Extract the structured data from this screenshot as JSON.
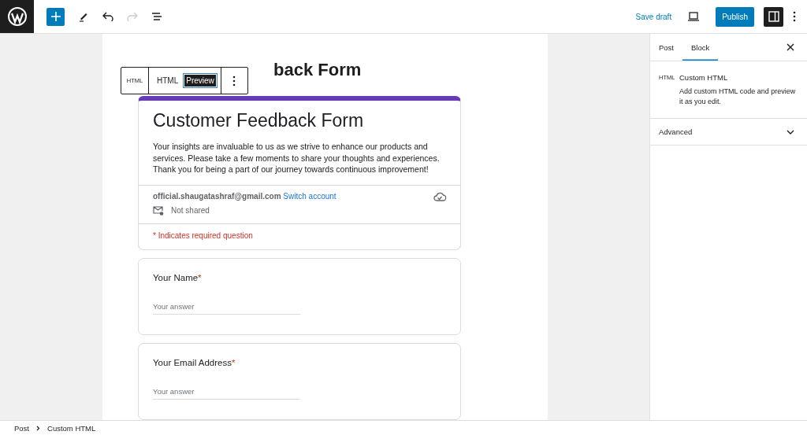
{
  "toolbar": {
    "save_draft": "Save draft",
    "publish": "Publish",
    "settings_on": true
  },
  "block_toolbar": {
    "block_icon": "HTML",
    "tabs": [
      {
        "label": "HTML",
        "selected": false
      },
      {
        "label": "Preview",
        "selected": true
      }
    ]
  },
  "post_title": "back Form",
  "form": {
    "title": "Customer Feedback Form",
    "description": "Your insights are invaluable to us as we strive to enhance our products and services. Please take a few moments to share your thoughts and experiences. Thank you for being a part of our journey towards continuous improvement!",
    "email": "official.shaugatashraf@gmail.com",
    "switch_account": "Switch account",
    "not_shared": "Not shared",
    "required_note": "* Indicates required question",
    "questions": [
      {
        "label": "Your Name",
        "required": true,
        "required_mark": "*",
        "placeholder": "Your answer"
      },
      {
        "label": "Your Email Address",
        "required": true,
        "required_mark": "*",
        "placeholder": "Your answer"
      }
    ]
  },
  "sidebar": {
    "tabs": [
      {
        "label": "Post",
        "selected": false
      },
      {
        "label": "Block",
        "selected": true
      }
    ],
    "block_icon": "HTML",
    "block_name": "Custom HTML",
    "block_description": "Add custom HTML code and preview it as you edit.",
    "panels": [
      {
        "label": "Advanced",
        "expanded": false
      }
    ]
  },
  "breadcrumb": [
    "Post",
    "Custom HTML"
  ]
}
